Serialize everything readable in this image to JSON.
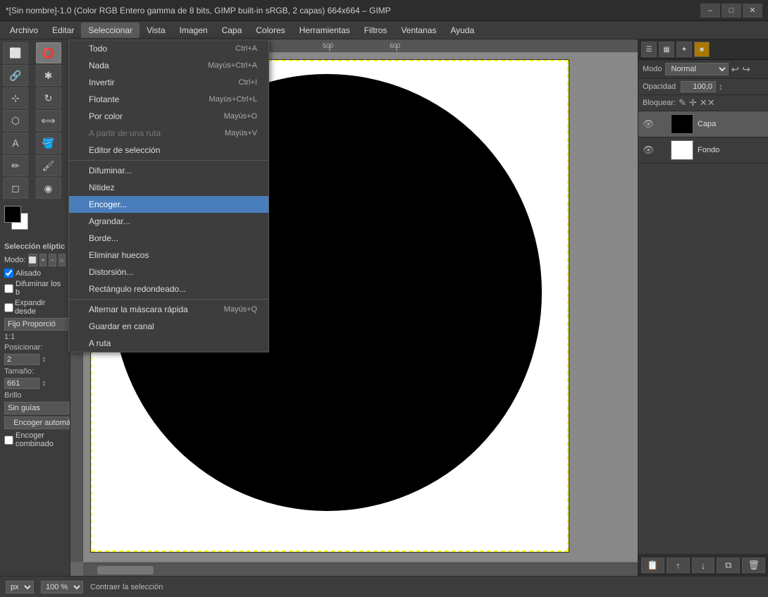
{
  "titleBar": {
    "text": "*[Sin nombre]-1.0 (Color RGB Entero gamma de 8 bits, GIMP built-in sRGB, 2 capas) 664x664 – GIMP",
    "minimizeLabel": "–",
    "maximizeLabel": "□",
    "closeLabel": "✕"
  },
  "menuBar": {
    "items": [
      "Archivo",
      "Editar",
      "Seleccionar",
      "Vista",
      "Imagen",
      "Capa",
      "Colores",
      "Herramientas",
      "Filtros",
      "Ventanas",
      "Ayuda"
    ]
  },
  "dropdownMenu": {
    "title": "Seleccionar",
    "items": [
      {
        "label": "Todo",
        "shortcut": "Ctrl+A",
        "check": false,
        "disabled": false,
        "highlighted": false,
        "separator_after": false
      },
      {
        "label": "Nada",
        "shortcut": "Mayús+Ctrl+A",
        "check": false,
        "disabled": false,
        "highlighted": false,
        "separator_after": false
      },
      {
        "label": "Invertir",
        "shortcut": "Ctrl+I",
        "check": false,
        "disabled": false,
        "highlighted": false,
        "separator_after": false
      },
      {
        "label": "Flotante",
        "shortcut": "Mayús+Ctrl+L",
        "check": false,
        "disabled": false,
        "highlighted": false,
        "separator_after": false
      },
      {
        "label": "Por color",
        "shortcut": "Mayús+O",
        "check": false,
        "disabled": false,
        "highlighted": false,
        "separator_after": false
      },
      {
        "label": "A partir de una ruta",
        "shortcut": "Mayús+V",
        "check": false,
        "disabled": true,
        "highlighted": false,
        "separator_after": false
      },
      {
        "label": "Editor de selección",
        "shortcut": "",
        "check": false,
        "disabled": false,
        "highlighted": false,
        "separator_after": true
      },
      {
        "label": "Difuminar...",
        "shortcut": "",
        "check": false,
        "disabled": false,
        "highlighted": false,
        "separator_after": false
      },
      {
        "label": "Nitidez",
        "shortcut": "",
        "check": false,
        "disabled": false,
        "highlighted": false,
        "separator_after": false
      },
      {
        "label": "Encoger...",
        "shortcut": "",
        "check": false,
        "disabled": false,
        "highlighted": true,
        "separator_after": false
      },
      {
        "label": "Agrandar...",
        "shortcut": "",
        "check": false,
        "disabled": false,
        "highlighted": false,
        "separator_after": false
      },
      {
        "label": "Borde...",
        "shortcut": "",
        "check": false,
        "disabled": false,
        "highlighted": false,
        "separator_after": false
      },
      {
        "label": "Eliminar huecos",
        "shortcut": "",
        "check": false,
        "disabled": false,
        "highlighted": false,
        "separator_after": false
      },
      {
        "label": "Distorsión...",
        "shortcut": "",
        "check": false,
        "disabled": false,
        "highlighted": false,
        "separator_after": false
      },
      {
        "label": "Rectángulo redondeado...",
        "shortcut": "",
        "check": false,
        "disabled": false,
        "highlighted": false,
        "separator_after": true
      },
      {
        "label": "Alternar la máscara rápida",
        "shortcut": "Mayús+Q",
        "check": false,
        "disabled": false,
        "highlighted": false,
        "separator_after": false
      },
      {
        "label": "Guardar en canal",
        "shortcut": "",
        "check": false,
        "disabled": false,
        "highlighted": false,
        "separator_after": false
      },
      {
        "label": "A ruta",
        "shortcut": "",
        "check": false,
        "disabled": false,
        "highlighted": false,
        "separator_after": false
      }
    ]
  },
  "toolOptions": {
    "title": "Selección elíptic",
    "modeLabel": "Modo:",
    "aliasLabel": "Alisado",
    "aliasChecked": true,
    "difuminarlabels": "Difuminar los b",
    "expandirLabel": "Expandir desde",
    "fijoLabel": "Fijo Proporció",
    "ratio": "1:1",
    "posicionarLabel": "Posicionar:",
    "posicionarValue": "2",
    "tamanoLabel": "Tamaño:",
    "tamanoValue": "661",
    "brilloLabel": "Brillo",
    "guiasLabel": "Sin guías",
    "encogerAutoLabel": "Encoger automáticamente",
    "encogerCombinadoLabel": "Encoger combinado"
  },
  "statusBar": {
    "unit": "px",
    "zoom": "100 %",
    "message": "Contraer la selección"
  },
  "layers": {
    "modeLabel": "Modo",
    "modeValue": "Normal",
    "opacityLabel": "Opacidad",
    "opacityValue": "100,0",
    "lockLabel": "Bloquear:",
    "items": [
      {
        "name": "Capa",
        "visible": true,
        "type": "black-circle"
      },
      {
        "name": "Fondo",
        "visible": true,
        "type": "white"
      }
    ]
  }
}
